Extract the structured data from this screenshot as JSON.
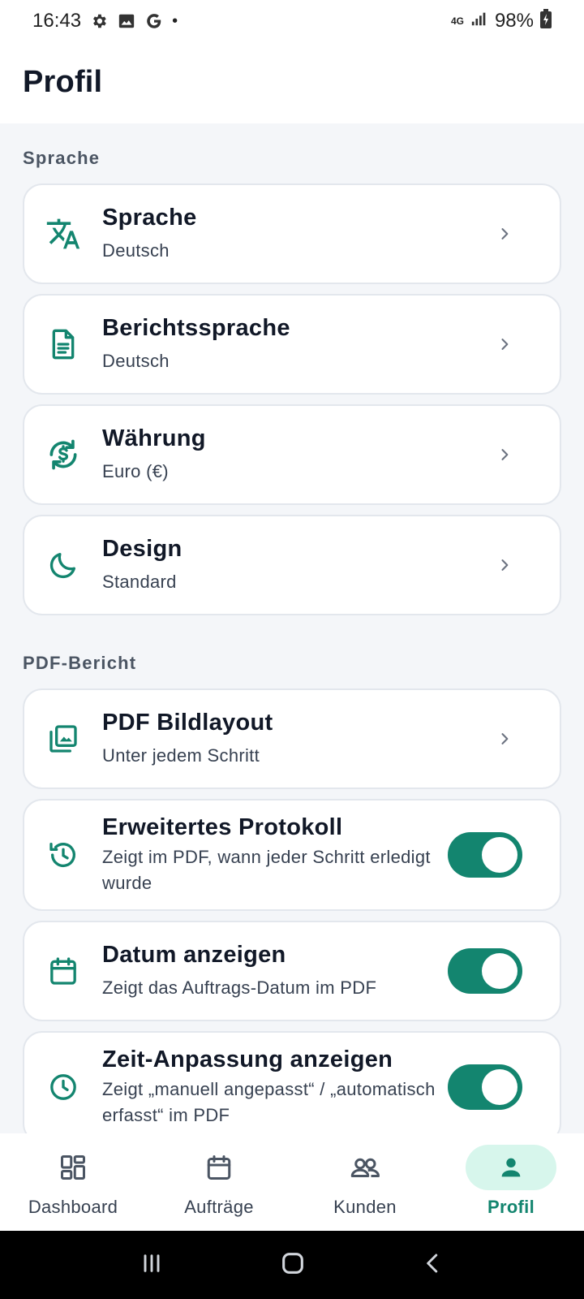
{
  "status_bar": {
    "time": "16:43",
    "network": "4G",
    "battery": "98%"
  },
  "header": {
    "title": "Profil"
  },
  "sections": [
    {
      "title": "Sprache"
    },
    {
      "title": "PDF-Bericht"
    }
  ],
  "settings": {
    "sprache": {
      "title": "Sprache",
      "value": "Deutsch",
      "icon": "translate-icon"
    },
    "berichtssprache": {
      "title": "Berichtssprache",
      "value": "Deutsch",
      "icon": "document-icon"
    },
    "waehrung": {
      "title": "Währung",
      "value": "Euro (€)",
      "icon": "currency-exchange-icon"
    },
    "design": {
      "title": "Design",
      "value": "Standard",
      "icon": "moon-icon"
    },
    "pdf_bildlayout": {
      "title": "PDF Bildlayout",
      "value": "Unter jedem Schritt",
      "icon": "image-gallery-icon"
    },
    "erweitertes_protokoll": {
      "title": "Erweitertes Protokoll",
      "description": "Zeigt im PDF, wann jeder Schritt erledigt wurde",
      "enabled": true,
      "icon": "history-icon"
    },
    "datum_anzeigen": {
      "title": "Datum anzeigen",
      "description": "Zeigt das Auftrags-Datum im PDF",
      "enabled": true,
      "icon": "calendar-icon"
    },
    "zeit_anpassung": {
      "title": "Zeit-Anpassung anzeigen",
      "description": "Zeigt „manuell angepasst“ / „automatisch erfasst“ im PDF",
      "enabled": true,
      "icon": "clock-icon"
    }
  },
  "bottom_nav": {
    "items": [
      {
        "label": "Dashboard",
        "icon": "dashboard-icon",
        "active": false
      },
      {
        "label": "Aufträge",
        "icon": "calendar-icon",
        "active": false
      },
      {
        "label": "Kunden",
        "icon": "people-icon",
        "active": false
      },
      {
        "label": "Profil",
        "icon": "person-icon",
        "active": true
      }
    ]
  },
  "colors": {
    "accent": "#13856f",
    "accent_light": "#d7f6ec",
    "background": "#f4f6f9",
    "card_border": "#e3e7ed"
  }
}
